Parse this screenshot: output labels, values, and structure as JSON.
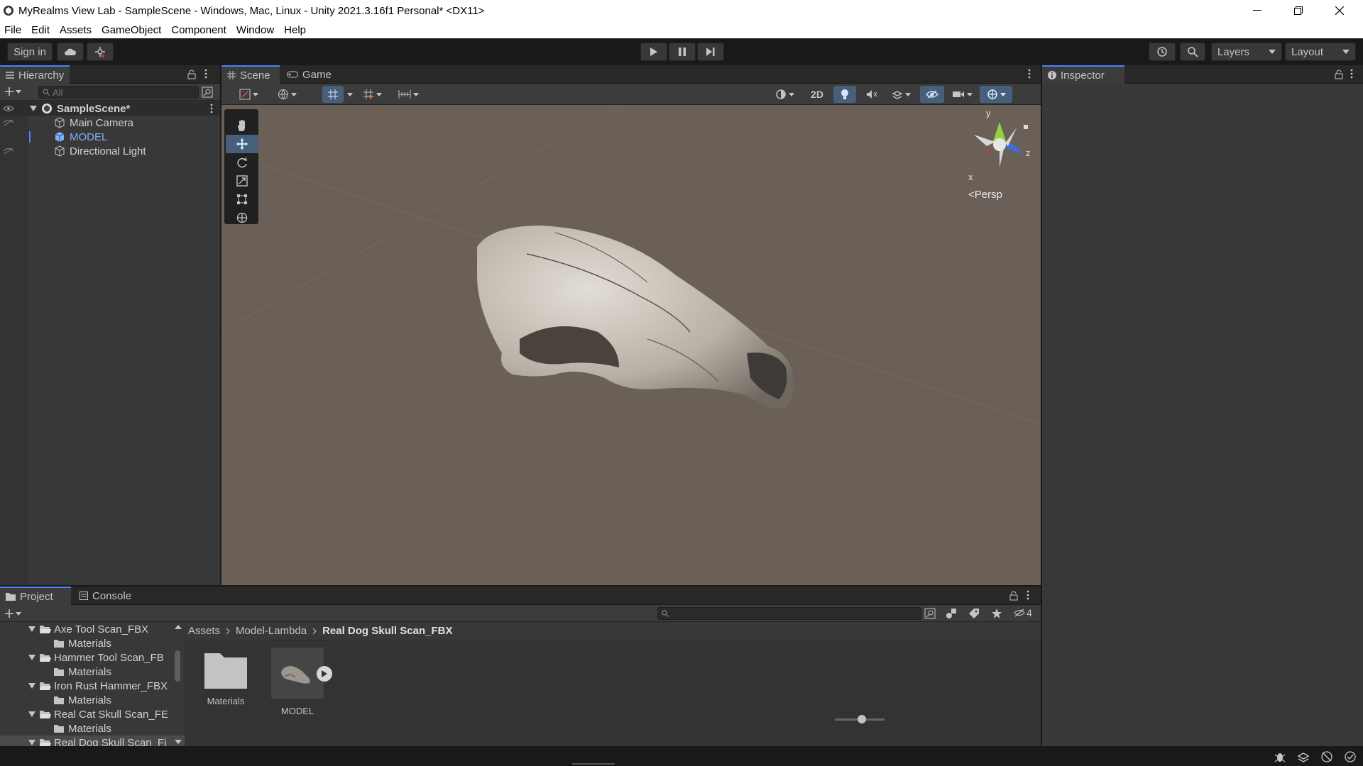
{
  "window": {
    "title": "MyRealms View Lab - SampleScene - Windows, Mac, Linux - Unity 2021.3.16f1 Personal* <DX11>"
  },
  "menu": {
    "items": [
      "File",
      "Edit",
      "Assets",
      "GameObject",
      "Component",
      "Window",
      "Help"
    ]
  },
  "toolbar": {
    "sign_in": "Sign in",
    "layers": "Layers",
    "layout": "Layout"
  },
  "hierarchy": {
    "tab": "Hierarchy",
    "search_placeholder": "All",
    "scene": "SampleScene*",
    "items": [
      "Main Camera",
      "MODEL",
      "Directional Light"
    ]
  },
  "scene_view": {
    "tabs": [
      "Scene",
      "Game"
    ],
    "mode_2d": "2D",
    "gizmo": {
      "y": "y",
      "z": "z",
      "x": "x",
      "persp": "<Persp"
    }
  },
  "inspector": {
    "tab": "Inspector"
  },
  "project": {
    "tabs": [
      "Project",
      "Console"
    ],
    "tree": [
      {
        "label": "Axe Tool Scan_FBX",
        "child": "Materials"
      },
      {
        "label": "Hammer Tool Scan_FB",
        "child": "Materials"
      },
      {
        "label": "Iron Rust Hammer_FBX",
        "child": "Materials"
      },
      {
        "label": "Real Cat Skull Scan_FE",
        "child": "Materials"
      },
      {
        "label": "Real Dog Skull Scan_Fi"
      }
    ],
    "breadcrumb": [
      "Assets",
      "Model-Lambda",
      "Real Dog Skull Scan_FBX"
    ],
    "assets": [
      {
        "label": "Materials",
        "icon": "folder-icon"
      },
      {
        "label": "MODEL",
        "icon": "model-thumbnail"
      }
    ],
    "hidden_count": "4"
  },
  "colors": {
    "accent": "#4f80f8",
    "selected_blue": "#46607c",
    "model_text": "#7fb0ff",
    "scene_bg": "#6b6058"
  }
}
